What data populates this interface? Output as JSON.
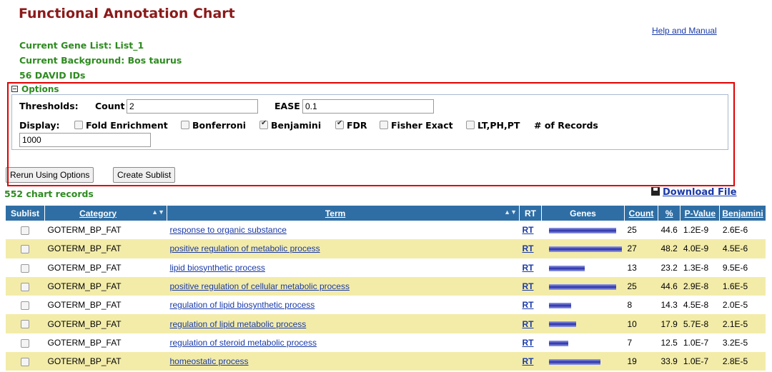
{
  "page": {
    "title": "Functional Annotation Chart",
    "help_link": "Help and Manual",
    "gene_list": "Current Gene List: List_1",
    "background": "Current Background: Bos taurus",
    "david_ids": "56 DAVID IDs"
  },
  "options": {
    "legend": "Options",
    "thresholds_label": "Thresholds:",
    "count_label": "Count",
    "count_value": "2",
    "ease_label": "EASE",
    "ease_value": "0.1",
    "display_label": "Display:",
    "checkboxes": [
      {
        "label": "Fold Enrichment",
        "checked": false
      },
      {
        "label": "Bonferroni",
        "checked": false
      },
      {
        "label": "Benjamini",
        "checked": true
      },
      {
        "label": "FDR",
        "checked": true
      },
      {
        "label": "Fisher Exact",
        "checked": false
      },
      {
        "label": "LT,PH,PT",
        "checked": false
      }
    ],
    "records_label": "# of Records",
    "records_value": "1000"
  },
  "buttons": {
    "rerun": "Rerun Using Options",
    "sublist": "Create Sublist"
  },
  "records_count": "552 chart records",
  "download": "Download File",
  "table": {
    "headers": {
      "sublist": "Sublist",
      "category": "Category",
      "term": "Term",
      "rt": "RT",
      "genes": "Genes",
      "count": "Count",
      "percent": "%",
      "pvalue": "P-Value",
      "benjamini": "Benjamini"
    },
    "rows": [
      {
        "category": "GOTERM_BP_FAT",
        "term": "response to organic substance",
        "rt": "RT",
        "count": "25",
        "percent": "44.6",
        "pvalue": "1.2E-9",
        "benjamini": "2.6E-6"
      },
      {
        "category": "GOTERM_BP_FAT",
        "term": "positive regulation of metabolic process",
        "rt": "RT",
        "count": "27",
        "percent": "48.2",
        "pvalue": "4.0E-9",
        "benjamini": "4.5E-6"
      },
      {
        "category": "GOTERM_BP_FAT",
        "term": "lipid biosynthetic process",
        "rt": "RT",
        "count": "13",
        "percent": "23.2",
        "pvalue": "1.3E-8",
        "benjamini": "9.5E-6"
      },
      {
        "category": "GOTERM_BP_FAT",
        "term": "positive regulation of cellular metabolic process",
        "rt": "RT",
        "count": "25",
        "percent": "44.6",
        "pvalue": "2.9E-8",
        "benjamini": "1.6E-5"
      },
      {
        "category": "GOTERM_BP_FAT",
        "term": "regulation of lipid biosynthetic process",
        "rt": "RT",
        "count": "8",
        "percent": "14.3",
        "pvalue": "4.5E-8",
        "benjamini": "2.0E-5"
      },
      {
        "category": "GOTERM_BP_FAT",
        "term": "regulation of lipid metabolic process",
        "rt": "RT",
        "count": "10",
        "percent": "17.9",
        "pvalue": "5.7E-8",
        "benjamini": "2.1E-5"
      },
      {
        "category": "GOTERM_BP_FAT",
        "term": "regulation of steroid metabolic process",
        "rt": "RT",
        "count": "7",
        "percent": "12.5",
        "pvalue": "1.0E-7",
        "benjamini": "3.2E-5"
      },
      {
        "category": "GOTERM_BP_FAT",
        "term": "homeostatic process",
        "rt": "RT",
        "count": "19",
        "percent": "33.9",
        "pvalue": "1.0E-7",
        "benjamini": "2.8E-5"
      }
    ]
  },
  "colors": {
    "title": "#8b1a1a",
    "green_text": "#2e8b20",
    "link": "#1a3aa8",
    "header_bg": "#2f6ea5",
    "alt_row": "#f3eca9",
    "highlight": "#e00000"
  },
  "icons": {
    "options_toggle": "collapse-minus-icon",
    "download": "floppy-disk-icon",
    "sort": "sort-arrows-icon"
  }
}
